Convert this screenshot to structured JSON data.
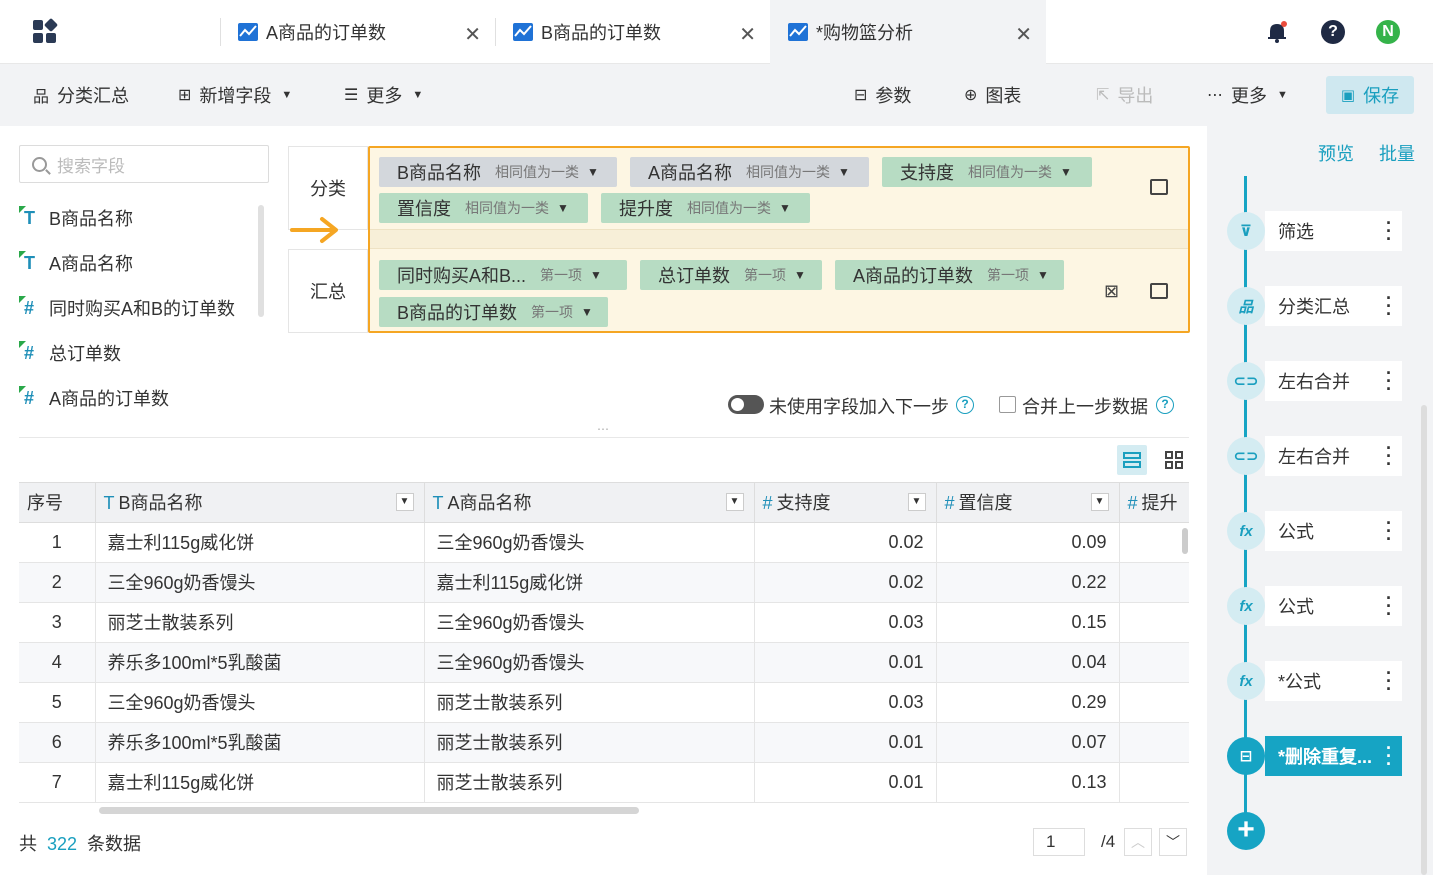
{
  "tabs": [
    {
      "label": "A商品的订单数"
    },
    {
      "label": "B商品的订单数"
    },
    {
      "label": "*购物篮分析",
      "active": true
    }
  ],
  "user": {
    "avatar_letter": "N",
    "help": "?"
  },
  "toolbar": {
    "group_summary": "分类汇总",
    "add_field": "新增字段",
    "more_left": "更多",
    "params": "参数",
    "chart": "图表",
    "export": "导出",
    "more_right": "更多",
    "save": "保存"
  },
  "search": {
    "placeholder": "搜索字段"
  },
  "fields": [
    {
      "name": "B商品名称",
      "type": "T"
    },
    {
      "name": "A商品名称",
      "type": "T"
    },
    {
      "name": "同时购买A和B的订单数",
      "type": "#"
    },
    {
      "name": "总订单数",
      "type": "#"
    },
    {
      "name": "A商品的订单数",
      "type": "#"
    }
  ],
  "group": {
    "category_label": "分类",
    "summary_label": "汇总",
    "category_chips": [
      {
        "name": "B商品名称",
        "mode": "相同值为一类"
      },
      {
        "name": "A商品名称",
        "mode": "相同值为一类"
      },
      {
        "name": "支持度",
        "mode": "相同值为一类"
      },
      {
        "name": "置信度",
        "mode": "相同值为一类"
      },
      {
        "name": "提升度",
        "mode": "相同值为一类"
      }
    ],
    "summary_chips": [
      {
        "name": "同时购买A和B...",
        "mode": "第一项"
      },
      {
        "name": "总订单数",
        "mode": "第一项"
      },
      {
        "name": "A商品的订单数",
        "mode": "第一项"
      },
      {
        "name": "B商品的订单数",
        "mode": "第一项"
      }
    ]
  },
  "options": {
    "unused_fields": "未使用字段加入下一步",
    "merge_prev": "合并上一步数据"
  },
  "table": {
    "headers": [
      "序号",
      "B商品名称",
      "A商品名称",
      "支持度",
      "置信度",
      "提升"
    ],
    "rows": [
      [
        "1",
        "嘉士利115g威化饼",
        "三全960g奶香馒头",
        "0.02",
        "0.09"
      ],
      [
        "2",
        "三全960g奶香馒头",
        "嘉士利115g威化饼",
        "0.02",
        "0.22"
      ],
      [
        "3",
        "丽芝士散装系列",
        "三全960g奶香馒头",
        "0.03",
        "0.15"
      ],
      [
        "4",
        "养乐多100ml*5乳酸菌",
        "三全960g奶香馒头",
        "0.01",
        "0.04"
      ],
      [
        "5",
        "三全960g奶香馒头",
        "丽芝士散装系列",
        "0.03",
        "0.29"
      ],
      [
        "6",
        "养乐多100ml*5乳酸菌",
        "丽芝士散装系列",
        "0.01",
        "0.07"
      ],
      [
        "7",
        "嘉士利115g威化饼",
        "丽芝士散装系列",
        "0.01",
        "0.13"
      ]
    ]
  },
  "footer": {
    "prefix": "共",
    "count": "322",
    "suffix": "条数据",
    "page": "1",
    "total_pages": "/4"
  },
  "right": {
    "preview": "预览",
    "batch": "批量",
    "steps": [
      {
        "label": "筛选",
        "icon": "filter-icon"
      },
      {
        "label": "分类汇总",
        "icon": "group-icon"
      },
      {
        "label": "左右合并",
        "icon": "join-icon"
      },
      {
        "label": "左右合并",
        "icon": "join-icon"
      },
      {
        "label": "公式",
        "icon": "formula-icon"
      },
      {
        "label": "公式",
        "icon": "formula-icon"
      },
      {
        "label": "*公式",
        "icon": "formula-icon"
      },
      {
        "label": "*删除重复...",
        "icon": "dedupe-icon",
        "active": true
      }
    ]
  },
  "colors": {
    "accent": "#16a4c4",
    "highlight_border": "#f5a623",
    "tab_icon": "#1f72d6"
  }
}
